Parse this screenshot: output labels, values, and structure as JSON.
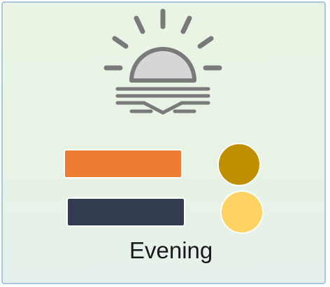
{
  "title": "Evening",
  "icon": "sunset-icon",
  "colors": {
    "sun_stroke": "#7a7a7a",
    "sun_fill": "#d6d6d6",
    "swatch_bar_1": "#ed7d31",
    "swatch_bar_2": "#323d52",
    "swatch_dot_1": "#c08f00",
    "swatch_dot_2": "#ffd363",
    "border": "#a7c7e3"
  }
}
